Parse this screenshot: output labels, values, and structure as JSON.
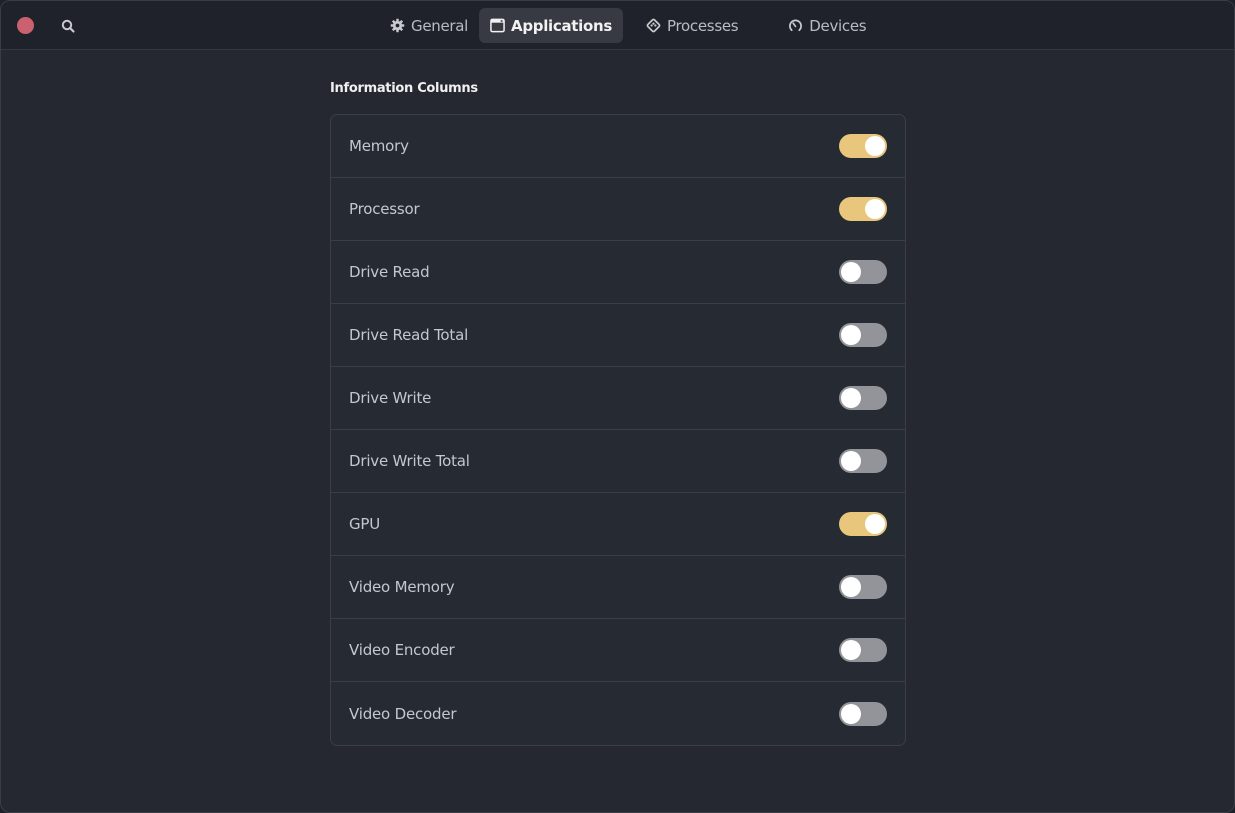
{
  "window": {
    "close_icon": "close-dot",
    "search_icon": "search-icon"
  },
  "tabs": [
    {
      "label": "General",
      "icon": "gear-icon",
      "active": false
    },
    {
      "label": "Applications",
      "icon": "window-icon",
      "active": true
    },
    {
      "label": "Processes",
      "icon": "diamond-icon",
      "active": false
    },
    {
      "label": "Devices",
      "icon": "gauge-icon",
      "active": false
    }
  ],
  "section": {
    "title": "Information Columns"
  },
  "columns": [
    {
      "label": "Memory",
      "enabled": true
    },
    {
      "label": "Processor",
      "enabled": true
    },
    {
      "label": "Drive Read",
      "enabled": false
    },
    {
      "label": "Drive Read Total",
      "enabled": false
    },
    {
      "label": "Drive Write",
      "enabled": false
    },
    {
      "label": "Drive Write Total",
      "enabled": false
    },
    {
      "label": "GPU",
      "enabled": true
    },
    {
      "label": "Video Memory",
      "enabled": false
    },
    {
      "label": "Video Encoder",
      "enabled": false
    },
    {
      "label": "Video Decoder",
      "enabled": false
    }
  ],
  "colors": {
    "accent_on": "#e8c77d",
    "toggle_off": "#92949a",
    "close": "#c9616f"
  }
}
